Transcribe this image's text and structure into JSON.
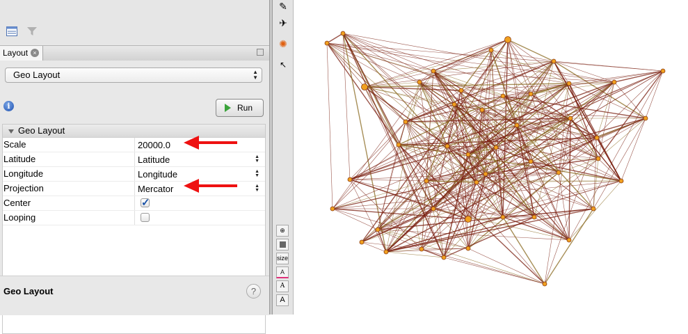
{
  "tab": {
    "label": "Layout",
    "close_glyph": "×"
  },
  "layout_select": {
    "value": "Geo Layout"
  },
  "run_button": {
    "label": "Run"
  },
  "properties": {
    "section_title": "Geo Layout",
    "rows": [
      {
        "name": "Scale",
        "value": "20000.0"
      },
      {
        "name": "Latitude",
        "value": "Latitude"
      },
      {
        "name": "Longitude",
        "value": "Longitude"
      },
      {
        "name": "Projection",
        "value": "Mercator"
      },
      {
        "name": "Center",
        "checked": true
      },
      {
        "name": "Looping",
        "checked": false
      }
    ]
  },
  "footer": {
    "title": "Geo Layout",
    "help_glyph": "?"
  },
  "toolbar": {
    "size_label": "size",
    "font_glyph": "A"
  },
  "info_glyph": "i",
  "colors": {
    "edge": "#7a1f10",
    "edge_light": "#8a6a20",
    "node": "#f0a020",
    "arrow": "#ee1111"
  }
}
